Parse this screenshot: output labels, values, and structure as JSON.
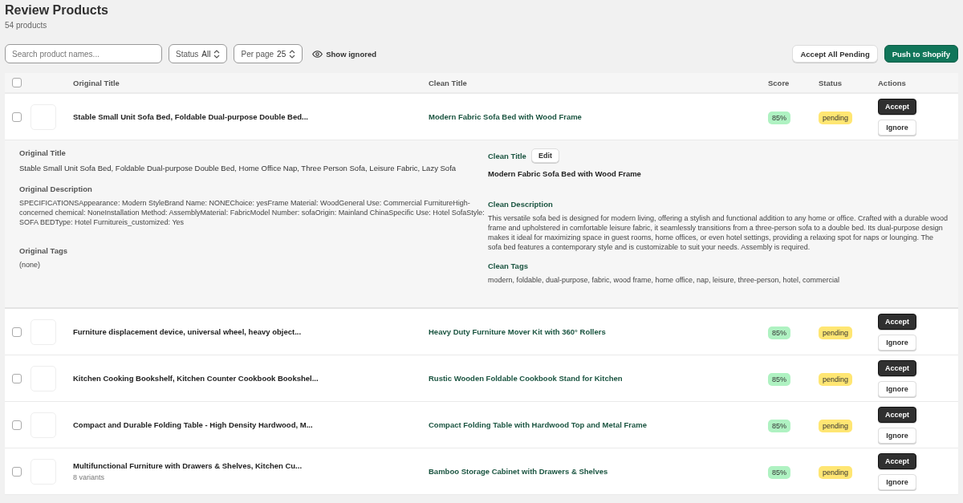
{
  "page": {
    "title": "Review Products",
    "count": "54 products"
  },
  "toolbar": {
    "search": {
      "placeholder": "Search product names..."
    },
    "status_select": {
      "label": "Status",
      "value": "All"
    },
    "per_page_select": {
      "label": "Per page",
      "value": "25"
    },
    "show_ignored": {
      "label": "Show ignored",
      "on": false
    },
    "buttons": [
      {
        "label": "Accept All Pending",
        "kind": "secondary"
      },
      {
        "label": "Push to Shopify",
        "kind": "primary"
      }
    ]
  },
  "table": {
    "select_all": {
      "checked": false
    },
    "columns": [
      "Original Title",
      "Clean Title",
      "Score",
      "Status",
      "Actions"
    ],
    "rows": [
      {
        "selected": false,
        "original_title": "Stable Small Unit Sofa Bed, Foldable Dual-purpose Double Bed...",
        "clean_title": "Modern Fabric Sofa Bed with Wood Frame",
        "score": "85%",
        "status": "pending",
        "actions": [
          "Accept",
          "Ignore"
        ],
        "expanded": true,
        "details": {
          "original_title_label": "Original Title",
          "original_title": "Stable Small Unit Sofa Bed, Foldable Dual-purpose Double Bed, Home Office Nap, Three Person Sofa, Leisure Fabric, Lazy Sofa",
          "clean_title_label": "Clean Title",
          "edit_button": "Edit",
          "clean_title": "Modern Fabric Sofa Bed with Wood Frame",
          "original_description_label": "Original Description",
          "original_description": "SPECIFICATIONSAppearance: Modern StyleBrand Name: NONEChoice: yesFrame Material: WoodGeneral Use: Commercial FurnitureHigh-concerned chemical: NoneInstallation Method: AssemblyMaterial: FabricModel Number: sofaOrigin: Mainland ChinaSpecific Use: Hotel SofaStyle: SOFA BEDType: Hotel Furnitureis_customized: Yes",
          "clean_description_label": "Clean Description",
          "clean_description": "This versatile sofa bed is designed for modern living, offering a stylish and functional addition to any home or office. Crafted with a durable wood frame and upholstered in comfortable leisure fabric, it seamlessly transitions from a three-person sofa to a double bed. Its dual-purpose design makes it ideal for maximizing space in guest rooms, home offices, or even hotel settings, providing a relaxing spot for naps or lounging. The sofa bed features a contemporary style and is customizable to suit your needs. Assembly is required.",
          "original_tags_label": "Original Tags",
          "original_tags": "(none)",
          "clean_tags_label": "Clean Tags",
          "clean_tags": "modern, foldable, dual-purpose, fabric, wood frame, home office, nap, leisure, three-person, hotel, commercial"
        }
      },
      {
        "selected": false,
        "original_title": "Furniture displacement device, universal wheel, heavy object...",
        "clean_title": "Heavy Duty Furniture Mover Kit with 360° Rollers",
        "score": "85%",
        "status": "pending",
        "actions": [
          "Accept",
          "Ignore"
        ],
        "expanded": false
      },
      {
        "selected": false,
        "original_title": "Kitchen Cooking Bookshelf, Kitchen Counter Cookbook Bookshel...",
        "clean_title": "Rustic Wooden Foldable Cookbook Stand for Kitchen",
        "score": "85%",
        "status": "pending",
        "actions": [
          "Accept",
          "Ignore"
        ],
        "expanded": false
      },
      {
        "selected": false,
        "original_title": "Compact and Durable Folding Table - High Density Hardwood, M...",
        "clean_title": "Compact Folding Table with Hardwood Top and Metal Frame",
        "score": "85%",
        "status": "pending",
        "actions": [
          "Accept",
          "Ignore"
        ],
        "expanded": false
      },
      {
        "selected": false,
        "original_title": "Multifunctional Furniture with Drawers & Shelves, Kitchen Cu...",
        "variants": "8 variants",
        "clean_title": "Bamboo Storage Cabinet with Drawers & Shelves",
        "score": "85%",
        "status": "pending",
        "actions": [
          "Accept",
          "Ignore"
        ],
        "expanded": false
      }
    ]
  }
}
